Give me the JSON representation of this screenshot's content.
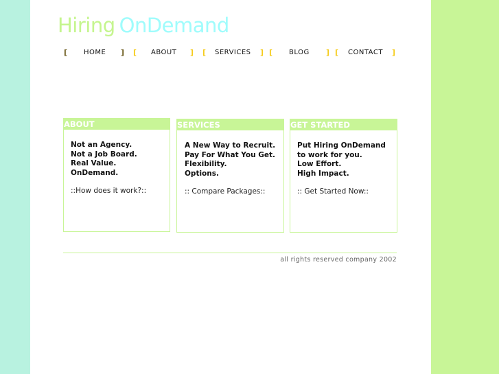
{
  "logo": {
    "part1": "Hiring",
    "part2": "OnDemand"
  },
  "nav": [
    {
      "label": "HOME"
    },
    {
      "label": "ABOUT"
    },
    {
      "label": "SERVICES"
    },
    {
      "label": "BLOG"
    },
    {
      "label": "CONTACT"
    }
  ],
  "brackets": {
    "open": "[",
    "close": "]"
  },
  "boxes": [
    {
      "title": "ABOUT",
      "lines": [
        "Not an Agency.",
        "Not a Job Board.",
        "Real Value.",
        "OnDemand."
      ],
      "link": "::How does it work?::"
    },
    {
      "title": "SERVICES",
      "lines": [
        "A New Way to Recruit.",
        "Pay For What You Get.",
        "Flexibility.",
        "Options."
      ],
      "link": ":: Compare Packages::"
    },
    {
      "title": "GET STARTED",
      "lines": [
        "Put Hiring OnDemand",
        "to work for you.",
        "Low Effort.",
        "High Impact."
      ],
      "link": ":: Get Started Now::"
    }
  ],
  "footer": {
    "text": "all rights reserved company 2002"
  },
  "colors": {
    "green": "#c8f597",
    "mint": "#b8f2e0",
    "cyan": "#9ffcfc",
    "bracket": "#f5cc1c"
  }
}
